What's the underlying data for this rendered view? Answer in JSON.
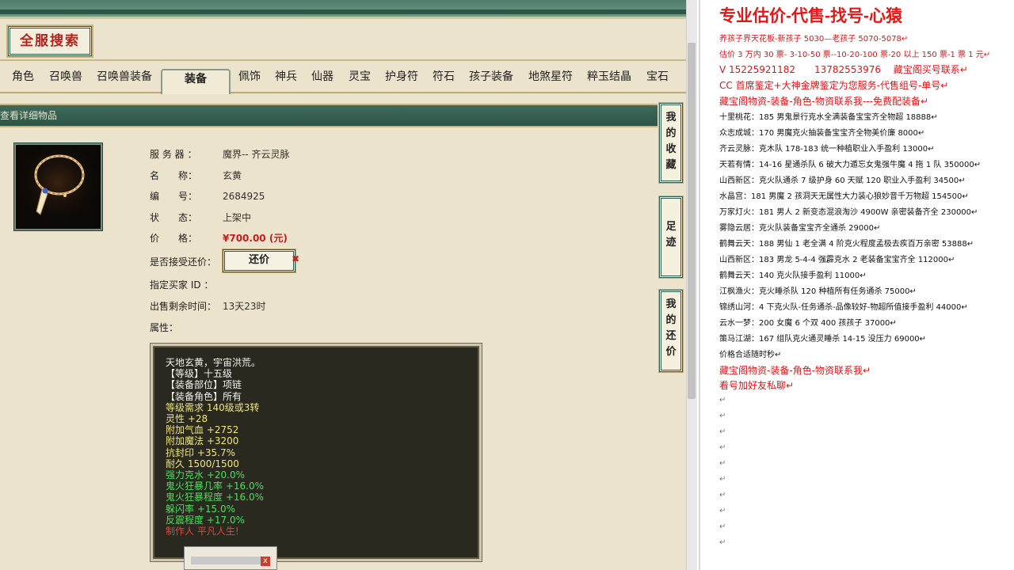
{
  "game": {
    "search_title": "全服搜索",
    "tabs": [
      "角色",
      "召唤兽",
      "召唤兽装备",
      "装备",
      "佩饰",
      "神兵",
      "仙器",
      "灵宝",
      "护身符",
      "符石",
      "孩子装备",
      "地煞星符",
      "粹玉结晶",
      "宝石"
    ],
    "active_tab": "装备",
    "detail_header": "查看详细物品",
    "info": [
      {
        "label": "服 务 器 ：",
        "value": "魔界-- 齐云灵脉"
      },
      {
        "label": "名　　称：",
        "value": "玄黄"
      },
      {
        "label": "编　　号：",
        "value": "2684925"
      },
      {
        "label": "状　　态：",
        "value": "上架中"
      },
      {
        "label": "价　　格：",
        "value": "¥700.00 (元)"
      }
    ],
    "counter_label": "是否接受还价：",
    "counter_button": "还价",
    "counter_x": "✖",
    "buyer_label": "指定买家 ID ：",
    "time_label": "出售剩余时间：",
    "time_value": "13天23时",
    "attr_label": "属性：",
    "attributes": [
      {
        "text": "天地玄黄，宇宙洪荒。",
        "color": "white"
      },
      {
        "text": "【等级】十五级",
        "color": "white"
      },
      {
        "text": "【装备部位】项链",
        "color": "white"
      },
      {
        "text": "【装备角色】所有",
        "color": "white"
      },
      {
        "text": "等级需求 140级或3转",
        "color": "yellow"
      },
      {
        "text": "灵性 +28",
        "color": "yellow"
      },
      {
        "text": "附加气血 +2752",
        "color": "yellow"
      },
      {
        "text": "附加魔法 +3200",
        "color": "yellow"
      },
      {
        "text": "抗封印 +35.7%",
        "color": "yellow"
      },
      {
        "text": "耐久 1500/1500",
        "color": "yellow"
      },
      {
        "text": "强力克水 +20.0%",
        "color": "green"
      },
      {
        "text": "鬼火狂暴几率 +16.0%",
        "color": "green"
      },
      {
        "text": "鬼火狂暴程度 +16.0%",
        "color": "green"
      },
      {
        "text": "躲闪率 +15.0%",
        "color": "green"
      },
      {
        "text": "反震程度 +17.0%",
        "color": "green"
      },
      {
        "text": "制作人 平凡人生!",
        "color": "red"
      }
    ],
    "side_buttons": [
      "我的收藏",
      "足迹",
      "我的还价"
    ]
  },
  "doc": {
    "title": "专业估价-代售-找号-心猿",
    "lines": [
      {
        "text": "养孩子界天花板-新孩子 5030—老孩子 5070-5078↵",
        "color": "red",
        "size": "small"
      },
      {
        "text": "估价 3 万内 30 票- 3-10-50 票--10-20-100 票-20 以上 150 票-1 票 1 元↵",
        "color": "red",
        "size": "small"
      },
      {
        "text": "V 15225921182　　13782553976　 藏宝阁买号联系↵",
        "color": "red",
        "size": "big"
      },
      {
        "text": "CC 首席鉴定+大神金牌鉴定为您服务-代售组号-单号↵",
        "color": "red",
        "size": "big"
      },
      {
        "text": "藏宝阁物资-装备-角色-物资联系我---免费配装备↵",
        "color": "red",
        "size": "big"
      },
      {
        "text": "十里桃花：185 男鬼景行克水全满装备宝宝齐全物超 18888↵",
        "color": "dark",
        "size": "small"
      },
      {
        "text": "众志成城：170 男魔克火抽装备宝宝齐全物美价廉 8000↵",
        "color": "dark",
        "size": "small"
      },
      {
        "text": "齐云灵脉：克木队 178-183 统一种植职业入手盈利 13000↵",
        "color": "dark",
        "size": "small"
      },
      {
        "text": "天若有情：14-16 星通杀队 6 破大力遁忘女鬼强牛魔 4 拖 1 队 350000↵",
        "color": "dark",
        "size": "small"
      },
      {
        "text": "山西新区：克火队通杀 7 级护身 60 天赋 120 职业入手盈利 34500↵",
        "color": "dark",
        "size": "small"
      },
      {
        "text": "水晶宫：181 男魔 2 孩洞天无属性大力装心狼妙音千万物超 154500↵",
        "color": "dark",
        "size": "small"
      },
      {
        "text": "万家灯火：181 男人 2 新变态混浪淘沙 4900W 亲密装备齐全 230000↵",
        "color": "dark",
        "size": "small"
      },
      {
        "text": "雾隐云居：克火队装备宝宝齐全通杀 29000↵",
        "color": "dark",
        "size": "small"
      },
      {
        "text": "鹤舞云天：188 男仙 1 老全满 4 阶克火程度孟极去疾百万亲密 53888↵",
        "color": "dark",
        "size": "small"
      },
      {
        "text": "山西新区：183 男龙 5-4-4 强霹克水 2 老装备宝宝齐全 112000↵",
        "color": "dark",
        "size": "small"
      },
      {
        "text": "鹤舞云天：140 克火队接手盈利 11000↵",
        "color": "dark",
        "size": "small"
      },
      {
        "text": "江枫渔火：克火睡杀队 120 种植所有任务通杀 75000↵",
        "color": "dark",
        "size": "small"
      },
      {
        "text": "锦绣山河：4 下克火队-任务通杀-品像较好-物超所值接手盈利 44000↵",
        "color": "dark",
        "size": "small"
      },
      {
        "text": "云水一梦：200 女魔 6 个双 400 孩孩子 37000↵",
        "color": "dark",
        "size": "small"
      },
      {
        "text": "策马江湖：167 组队克火通灵睡杀 14-15 没压力 69000↵",
        "color": "dark",
        "size": "small"
      },
      {
        "text": "价格合适随时秒↵",
        "color": "dark",
        "size": "small"
      },
      {
        "text": "藏宝阁物资-装备-角色-物资联系我↵",
        "color": "red",
        "size": "big"
      },
      {
        "text": "看号加好友私聊↵",
        "color": "red",
        "size": "big"
      }
    ],
    "paragraph_mark": "↵"
  }
}
